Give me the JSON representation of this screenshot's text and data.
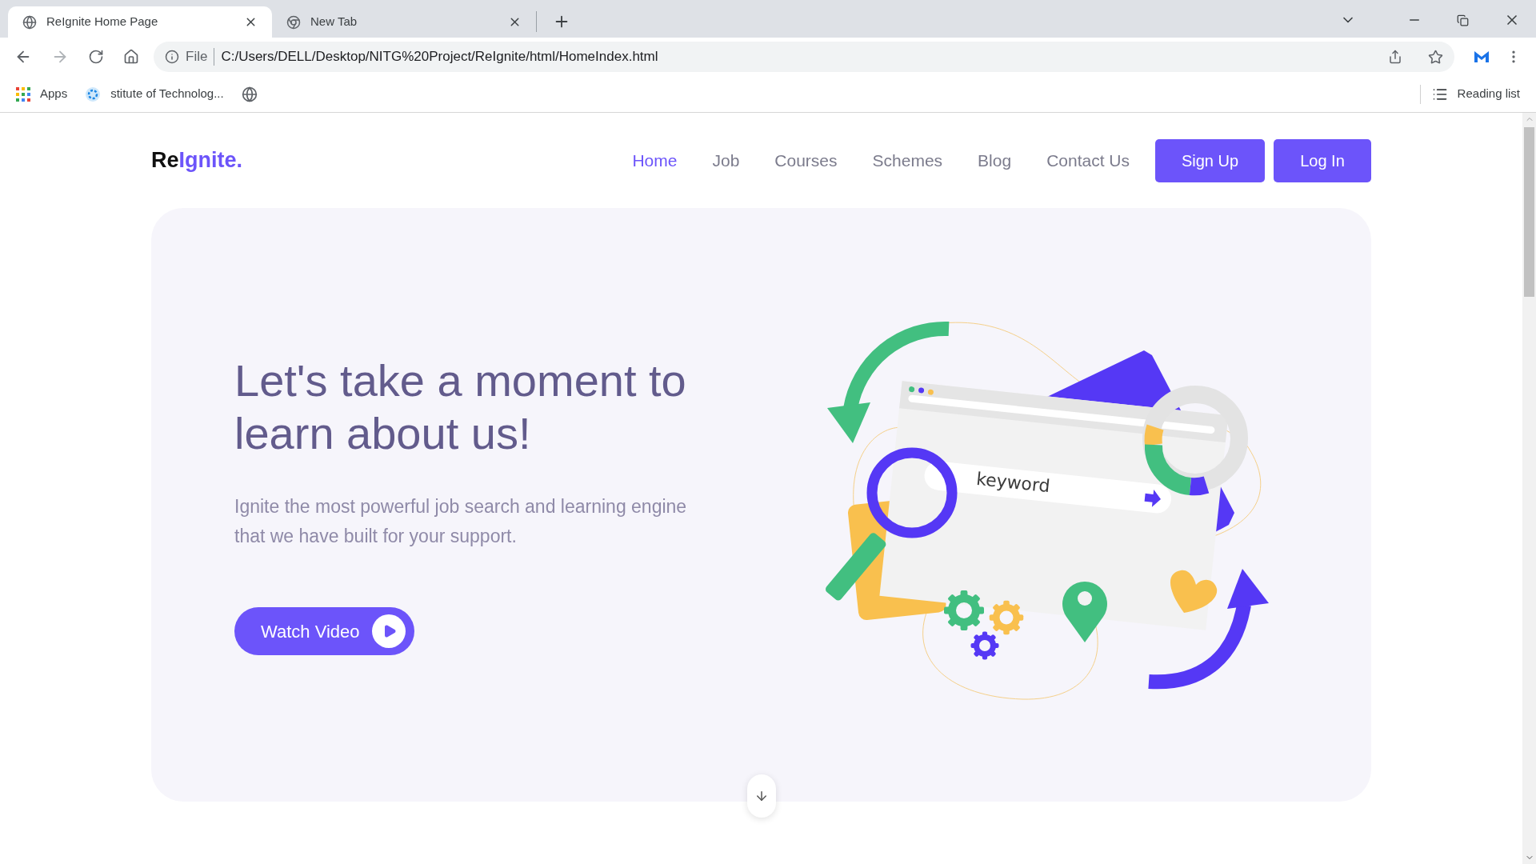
{
  "browser": {
    "tabs": [
      {
        "title": "ReIgnite Home Page",
        "selected": true
      },
      {
        "title": "New Tab",
        "selected": false
      }
    ],
    "address": {
      "scheme": "File",
      "url": "C:/Users/DELL/Desktop/NITG%20Project/ReIgnite/html/HomeIndex.html"
    },
    "bookmarks": [
      "Apps",
      "stitute of Technolog..."
    ],
    "reading_list": "Reading list"
  },
  "page": {
    "logo": {
      "prefix": "Re",
      "accent": "Ignite."
    },
    "nav": [
      {
        "label": "Home",
        "selected": true
      },
      {
        "label": "Job",
        "selected": false
      },
      {
        "label": "Courses",
        "selected": false
      },
      {
        "label": "Schemes",
        "selected": false
      },
      {
        "label": "Blog",
        "selected": false
      },
      {
        "label": "Contact Us",
        "selected": false
      }
    ],
    "buttons": [
      "Sign Up",
      "Log In"
    ],
    "hero": {
      "heading": "Let's take a moment to learn about us!",
      "text": "Ignite the most powerful job search and learning engine that we have built for your support.",
      "cta": "Watch Video",
      "illustration_text": "keyword"
    }
  }
}
